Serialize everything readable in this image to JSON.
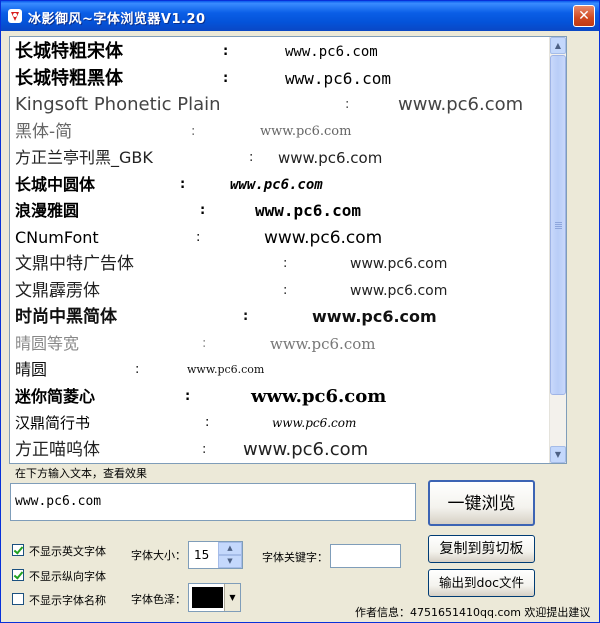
{
  "window": {
    "title": "冰影御风~字体浏览器V1.20",
    "close_glyph": "✕",
    "icon": "app-logo-icon"
  },
  "font_list": {
    "separator": ":",
    "sample": "www.pc6.com",
    "rows": [
      {
        "name": "长城特粗宋体"
      },
      {
        "name": "长城特粗黑体"
      },
      {
        "name": "Kingsoft Phonetic Plain"
      },
      {
        "name": "黑体-简"
      },
      {
        "name": "方正兰亭刊黑_GBK"
      },
      {
        "name": "长城中圆体"
      },
      {
        "name": "浪漫雅圆"
      },
      {
        "name": "CNumFont"
      },
      {
        "name": "文鼎中特广告体"
      },
      {
        "name": "文鼎霹雳体"
      },
      {
        "name": "时尚中黑简体"
      },
      {
        "name": "晴圆等宽"
      },
      {
        "name": "晴圆"
      },
      {
        "name": "迷你简菱心"
      },
      {
        "name": "汉鼎简行书"
      },
      {
        "name": "方正喵呜体"
      }
    ]
  },
  "preview": {
    "hint": "在下方输入文本，查看效果",
    "input_value": "www.pc6.com"
  },
  "buttons": {
    "browse": "一键浏览",
    "copy": "复制到剪切板",
    "export": "输出到doc文件"
  },
  "options": {
    "hide_english": {
      "label": "不显示英文字体",
      "checked": true
    },
    "hide_vertical": {
      "label": "不显示纵向字体",
      "checked": true
    },
    "hide_name": {
      "label": "不显示字体名称",
      "checked": false
    }
  },
  "settings": {
    "size_label": "字体大小：",
    "size_value": "15",
    "keyword_label": "字体关键字：",
    "keyword_value": "",
    "color_label": "字体色泽：",
    "color_value": "#000000"
  },
  "footer": {
    "author": "作者信息：4751651410qq.com 欢迎提出建议"
  }
}
